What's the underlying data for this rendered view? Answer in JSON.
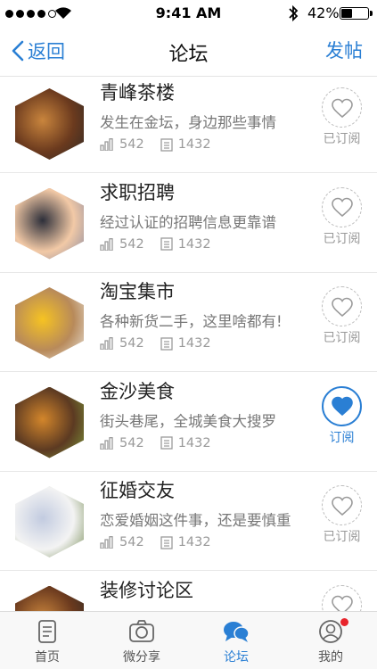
{
  "status_bar": {
    "time": "9:41 AM",
    "battery": "42%",
    "battery_level": 0.42
  },
  "nav": {
    "back_label": "返回",
    "title": "论坛",
    "post_label": "发帖"
  },
  "forums": [
    {
      "title": "青峰茶楼",
      "desc": "发生在金坛，身边那些事情",
      "views": "542",
      "posts": "1432",
      "subscribed": false,
      "sub_label": "已订阅",
      "thumb": [
        "#6b3a1e",
        "#c9853d",
        "#2f2a25"
      ]
    },
    {
      "title": "求职招聘",
      "desc": "经过认证的招聘信息更靠谱",
      "views": "542",
      "posts": "1432",
      "subscribed": false,
      "sub_label": "已订阅",
      "thumb": [
        "#f2c9a6",
        "#2d2f3a",
        "#8a8aa0"
      ]
    },
    {
      "title": "淘宝集市",
      "desc": "各种新货二手，这里啥都有!",
      "views": "542",
      "posts": "1432",
      "subscribed": false,
      "sub_label": "已订阅",
      "thumb": [
        "#b88a5a",
        "#f6c322",
        "#e9e4dc"
      ]
    },
    {
      "title": "金沙美食",
      "desc": "街头巷尾，全城美食大搜罗",
      "views": "542",
      "posts": "1432",
      "subscribed": true,
      "sub_label": "订阅",
      "thumb": [
        "#5c3a22",
        "#d3862b",
        "#7c9a3a"
      ]
    },
    {
      "title": "征婚交友",
      "desc": "恋爱婚姻这件事，还是要慎重",
      "views": "542",
      "posts": "1432",
      "subscribed": false,
      "sub_label": "已订阅",
      "thumb": [
        "#f3f3f3",
        "#c2cbe0",
        "#7a8f5a"
      ]
    },
    {
      "title": "装修讨论区",
      "desc": "",
      "views": "",
      "posts": "",
      "subscribed": false,
      "sub_label": "",
      "thumb": [
        "#6b3a1e",
        "#c9853d",
        "#2f2a25"
      ]
    }
  ],
  "tabs": [
    {
      "label": "首页",
      "icon": "document-icon",
      "active": false
    },
    {
      "label": "微分享",
      "icon": "camera-icon",
      "active": false
    },
    {
      "label": "论坛",
      "icon": "chat-bubbles-icon",
      "active": true
    },
    {
      "label": "我的",
      "icon": "user-icon",
      "active": false,
      "badge": true
    }
  ],
  "colors": {
    "accent": "#2a7fd4",
    "badge": "#e8242c"
  }
}
